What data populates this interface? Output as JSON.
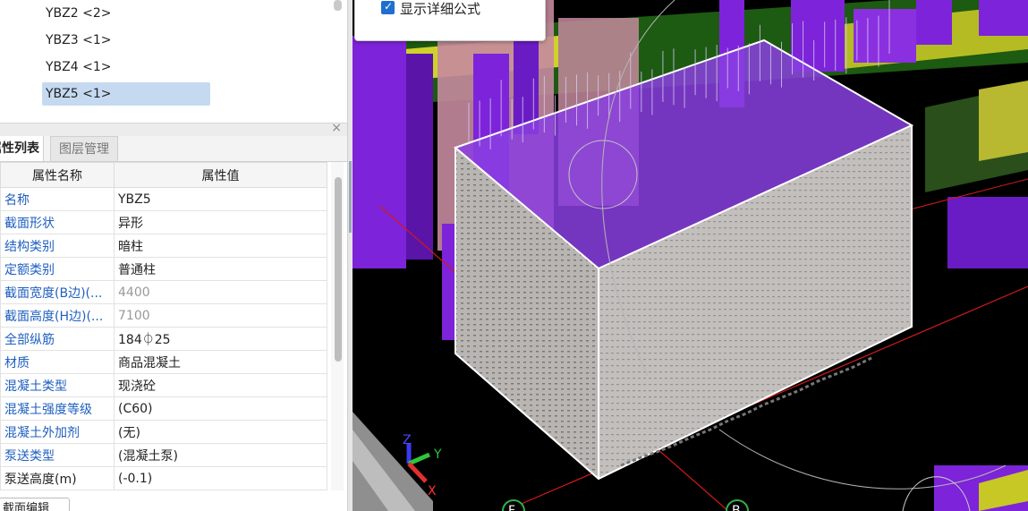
{
  "tree": {
    "items": [
      {
        "label": "YBZ2 <2>",
        "selected": false
      },
      {
        "label": "YBZ3 <1>",
        "selected": false
      },
      {
        "label": "YBZ4 <1>",
        "selected": false
      },
      {
        "label": "YBZ5 <1>",
        "selected": true
      }
    ]
  },
  "panel": {
    "close_glyph": "×",
    "tabs": [
      "属性列表",
      "图层管理"
    ],
    "active_tab": "属性列表"
  },
  "table": {
    "headers": [
      "属性名称",
      "属性值"
    ],
    "rows": [
      {
        "name": "名称",
        "value": "YBZ5",
        "name_style": "link",
        "value_style": "normal"
      },
      {
        "name": "截面形状",
        "value": "异形",
        "name_style": "link",
        "value_style": "normal"
      },
      {
        "name": "结构类别",
        "value": "暗柱",
        "name_style": "link",
        "value_style": "normal"
      },
      {
        "name": "定额类别",
        "value": "普通柱",
        "name_style": "link",
        "value_style": "normal"
      },
      {
        "name": "截面宽度(B边)(...",
        "value": "4400",
        "name_style": "link",
        "value_style": "gray"
      },
      {
        "name": "截面高度(H边)(...",
        "value": "7100",
        "name_style": "link",
        "value_style": "gray"
      },
      {
        "name": "全部纵筋",
        "value": "184⏀25",
        "name_style": "link",
        "value_style": "normal"
      },
      {
        "name": "材质",
        "value": "商品混凝土",
        "name_style": "link",
        "value_style": "normal"
      },
      {
        "name": "混凝土类型",
        "value": "现浇砼",
        "name_style": "link",
        "value_style": "normal"
      },
      {
        "name": "混凝土强度等级",
        "value": "(C60)",
        "name_style": "link",
        "value_style": "normal"
      },
      {
        "name": "混凝土外加剂",
        "value": "(无)",
        "name_style": "link",
        "value_style": "normal"
      },
      {
        "name": "泵送类型",
        "value": "(混凝土泵)",
        "name_style": "link",
        "value_style": "normal"
      },
      {
        "name": "泵送高度(m)",
        "value": "(-0.1)",
        "name_style": "plain",
        "value_style": "normal"
      }
    ]
  },
  "bottom_button": {
    "label": "截面编辑"
  },
  "popup": {
    "checkbox_label": "显示详细公式",
    "checked": true
  },
  "viewport": {
    "axis_labels": {
      "z": "Z",
      "y": "Y",
      "x": "X"
    },
    "grid_labels": [
      "F",
      "B"
    ],
    "colors": {
      "background": "#000000",
      "column": "#7b22d6",
      "pink": "#c8859d",
      "yellow": "#c9c92a",
      "wall": "#b9b5b2",
      "gridline": "#e01818"
    }
  }
}
